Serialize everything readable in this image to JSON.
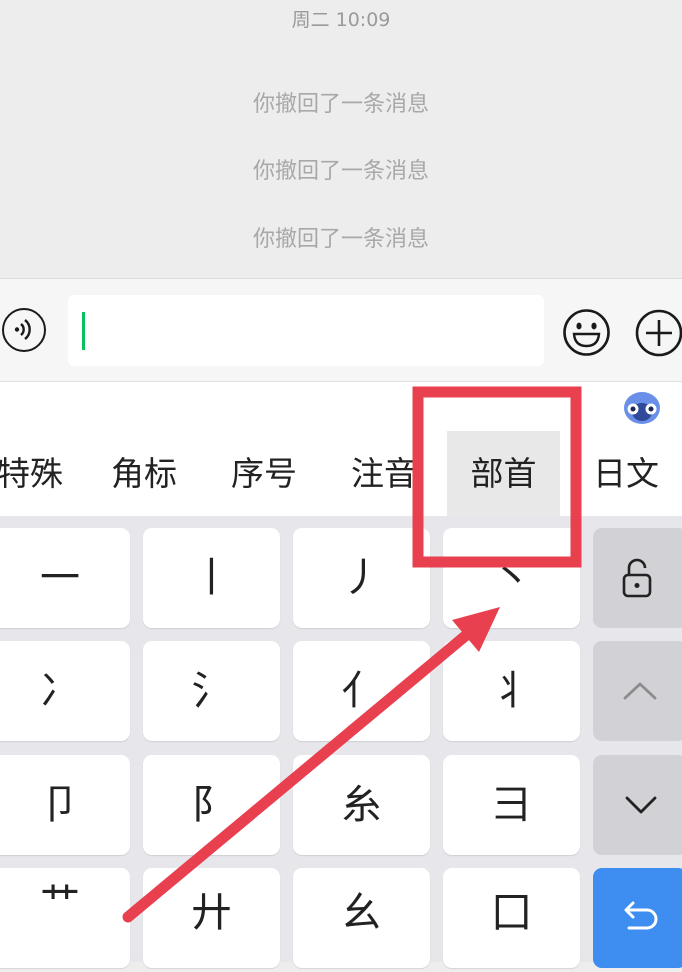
{
  "chat": {
    "timestamp": "周二 10:09",
    "system_messages": [
      "你撤回了一条消息",
      "你撤回了一条消息",
      "你撤回了一条消息"
    ]
  },
  "input": {
    "value": "",
    "accent_color": "#07c160"
  },
  "icons": {
    "voice": "voice-icon",
    "emoji": "emoji-icon",
    "plus": "plus-icon",
    "mascot": "mascot-icon",
    "lock": "unlock-icon",
    "up": "chevron-up-icon",
    "down": "chevron-down-icon",
    "enter": "return-icon"
  },
  "keyboard": {
    "categories": [
      "特殊",
      "角标",
      "序号",
      "注音",
      "部首",
      "日文"
    ],
    "active_category": "部首",
    "keys": [
      [
        "一",
        "丨",
        "丿",
        "丶"
      ],
      [
        "冫",
        "氵",
        "亻",
        "丬"
      ],
      [
        "卩",
        "阝",
        "糸",
        "彐"
      ],
      [
        "艹",
        "廾",
        "幺",
        "囗"
      ]
    ],
    "enter_color": "#3d8ef0"
  },
  "annotation": {
    "color": "#e8404f"
  }
}
